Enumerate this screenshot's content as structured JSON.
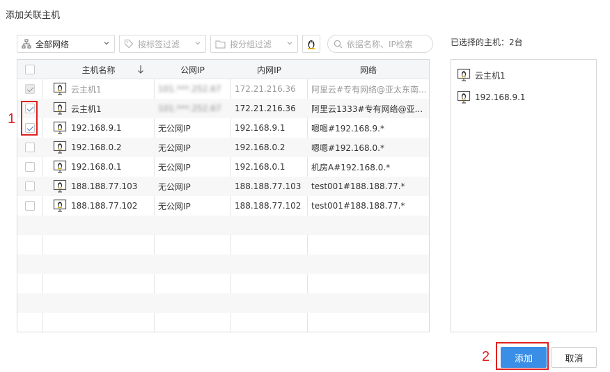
{
  "dialog": {
    "title": "添加关联主机"
  },
  "toolbar": {
    "network_select": "全部网络",
    "tag_filter_placeholder": "按标签过滤",
    "group_filter_placeholder": "按分组过滤",
    "search_placeholder": "依据名称、IP检索"
  },
  "table": {
    "columns": [
      "主机名称",
      "公网IP",
      "内网IP",
      "网络"
    ],
    "rows": [
      {
        "checked": true,
        "disabled": true,
        "name": "云主机1",
        "public_ip": "101.***.252.67",
        "private_ip": "172.21.216.36",
        "network": "阿里云#专有网络@亚太东南...",
        "public_blurred": true
      },
      {
        "checked": true,
        "disabled": false,
        "name": "云主机1",
        "public_ip": "101.***.252.67",
        "private_ip": "172.21.216.36",
        "network": "阿里云1333#专有网络@亚...",
        "public_blurred": true
      },
      {
        "checked": true,
        "disabled": false,
        "name": "192.168.9.1",
        "public_ip": "无公网IP",
        "private_ip": "192.168.9.1",
        "network": "嗯嗯#192.168.9.*"
      },
      {
        "checked": false,
        "disabled": false,
        "name": "192.168.0.2",
        "public_ip": "无公网IP",
        "private_ip": "192.168.0.2",
        "network": "嗯嗯#192.168.0.*"
      },
      {
        "checked": false,
        "disabled": false,
        "name": "192.168.0.1",
        "public_ip": "无公网IP",
        "private_ip": "192.168.0.1",
        "network": "机房A#192.168.0.*"
      },
      {
        "checked": false,
        "disabled": false,
        "name": "188.188.77.103",
        "public_ip": "无公网IP",
        "private_ip": "188.188.77.103",
        "network": "test001#188.188.77.*"
      },
      {
        "checked": false,
        "disabled": false,
        "name": "188.188.77.102",
        "public_ip": "无公网IP",
        "private_ip": "188.188.77.102",
        "network": "test001#188.188.77.*"
      }
    ]
  },
  "selected": {
    "title": "已选择的主机：2台",
    "items": [
      "云主机1",
      "192.168.9.1"
    ]
  },
  "footer": {
    "add_label": "添加",
    "cancel_label": "取消"
  },
  "annotations": {
    "step1": "1",
    "step2": "2"
  },
  "colors": {
    "primary": "#3a8ee6",
    "annotation": "#e02020"
  }
}
